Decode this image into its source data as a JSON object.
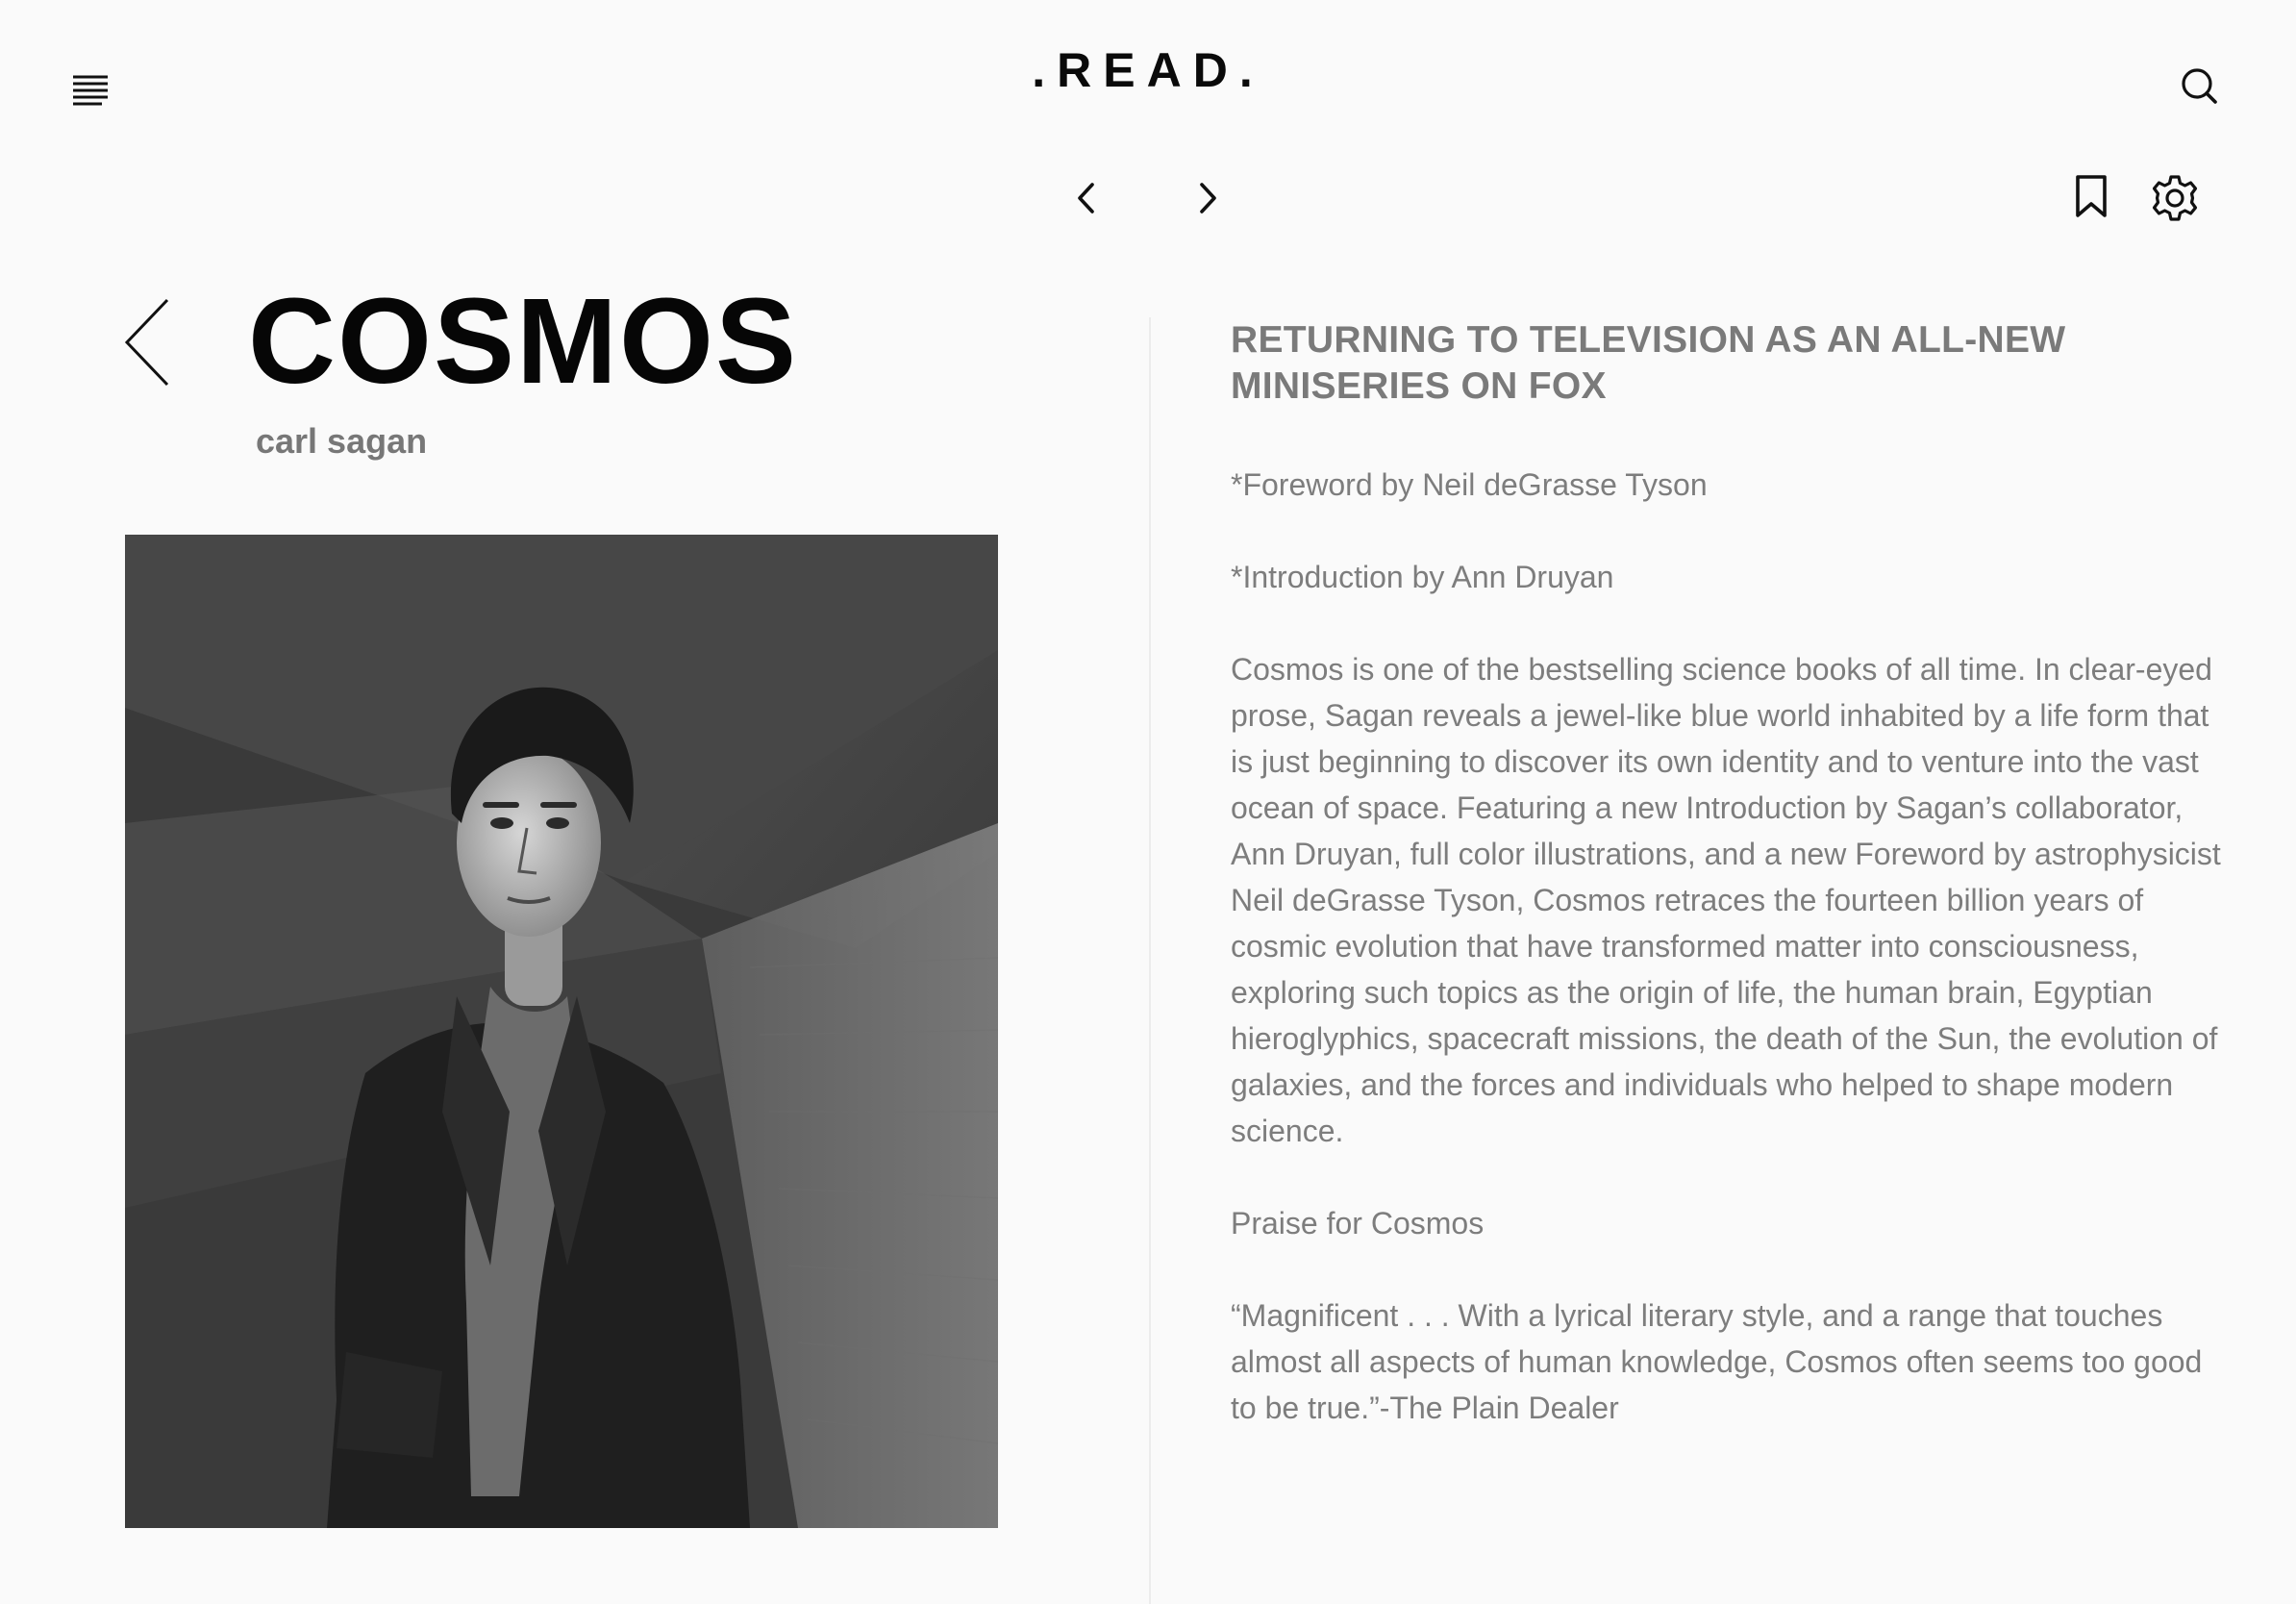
{
  "header": {
    "brand": ".READ."
  },
  "book": {
    "title": "COSMOS",
    "author": "carl sagan"
  },
  "content": {
    "headline": "RETURNING TO TELEVISION AS AN ALL-NEW MINISERIES ON FOX",
    "foreword": "*Foreword by Neil deGrasse Tyson",
    "introduction": "*Introduction by Ann Druyan",
    "description": "Cosmos is one of the bestselling science books of all time. In clear-eyed prose, Sagan reveals a jewel-like blue world inhabited by a life form that is just beginning to discover its own identity and to venture into the vast ocean of space. Featuring a new Introduction by Sagan’s collaborator, Ann Druyan, full color illustrations, and a new Foreword by astrophysicist Neil deGrasse Tyson, Cosmos retraces the fourteen billion years of cosmic evolution that have transformed matter into consciousness, exploring such topics as the origin of life, the human brain, Egyptian hieroglyphics, spacecraft missions, the death of the Sun, the evolution of galaxies, and the forces and individuals who helped to shape modern science.",
    "praise_heading": "Praise for Cosmos",
    "quote": "“Magnificent . . . With a lyrical literary style, and a range that touches almost all aspects of human knowledge, Cosmos often seems too good to be true.”-The Plain Dealer"
  },
  "icons": {
    "menu": "menu-icon",
    "search": "search-icon",
    "prev": "chevron-left-icon",
    "next": "chevron-right-icon",
    "bookmark": "bookmark-icon",
    "settings": "gear-icon",
    "back": "back-arrow-icon"
  },
  "colors": {
    "background": "#fafafa",
    "title": "#060606",
    "muted_text": "#7d7d7d",
    "divider": "#ececec"
  }
}
